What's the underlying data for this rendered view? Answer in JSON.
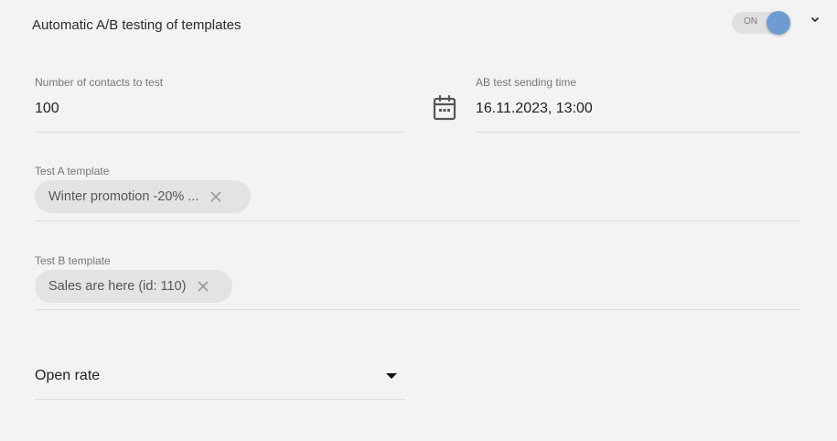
{
  "header": {
    "title": "Automatic A/B testing of templates",
    "toggle_label": "ON",
    "toggle_state": "on",
    "accent_color": "#6e9bd1"
  },
  "contacts_field": {
    "label": "Number of contacts to test",
    "value": "100"
  },
  "send_time_field": {
    "label": "AB test sending time",
    "value": "16.11.2023, 13:00",
    "icon": "calendar-icon"
  },
  "test_a": {
    "label": "Test A template",
    "chip": "Winter promotion -20% ..."
  },
  "test_b": {
    "label": "Test B template",
    "chip": "Sales are here (id: 110)"
  },
  "metric_select": {
    "selected": "Open rate"
  }
}
